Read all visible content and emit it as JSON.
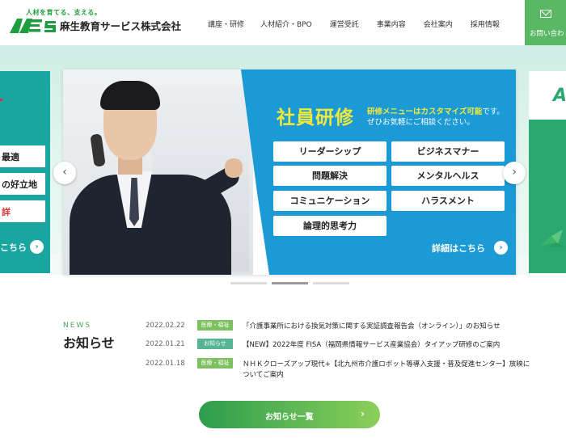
{
  "header": {
    "tagline": "人材を育てる、支える。",
    "logo_mark": "AES",
    "company_name": "麻生教育サービス株式会社",
    "nav": [
      "講座・研修",
      "人材紹介・BPO",
      "運営受託",
      "事業内容",
      "会社案内",
      "採用情報"
    ],
    "contact_label": "お問い合わ"
  },
  "slider": {
    "left_slide": {
      "chips": [
        "最適",
        "の好立地",
        "詳"
      ],
      "more_label": "こちら"
    },
    "main_slide": {
      "title": "社員研修",
      "sub_highlight": "研修メニューはカスタマイズ可能",
      "sub_rest": "です。",
      "sub_line2": "ぜひお気軽にご相談ください。",
      "tags": [
        "リーダーシップ",
        "ビジネスマナー",
        "問題解決",
        "メンタルヘルス",
        "コミュニケーション",
        "ハラスメント",
        "論理的思考力"
      ],
      "details_label": "詳細はこちら"
    },
    "right_slide": {
      "logo_fragment": "A"
    },
    "prev_icon": "‹",
    "next_icon": "›",
    "dots_active_index": 1
  },
  "news": {
    "label_en": "NEWS",
    "label_jp": "お知らせ",
    "items": [
      {
        "date": "2022.02.22",
        "category": "医療・福祉",
        "category_color": "#7cc060",
        "text": "「介護事業所における換気対策に関する実証調査報告会（オンライン）」のお知らせ",
        "text2": ""
      },
      {
        "date": "2022.01.21",
        "category": "お知らせ",
        "category_color": "#56b394",
        "text": "【NEW】2022年度 FISA（福岡県情報サービス産業協会）タイアップ研修のご案内",
        "text2": ""
      },
      {
        "date": "2022.01.18",
        "category": "医療・福祉",
        "category_color": "#7cc060",
        "text": "ＮＨＫクローズアップ現代+【北九州市介護ロボット等導入支援・普及促進センター】放映に",
        "text2": "ついてご案内"
      }
    ],
    "all_button_label": "お知らせ一覧",
    "all_button_icon": "›"
  }
}
